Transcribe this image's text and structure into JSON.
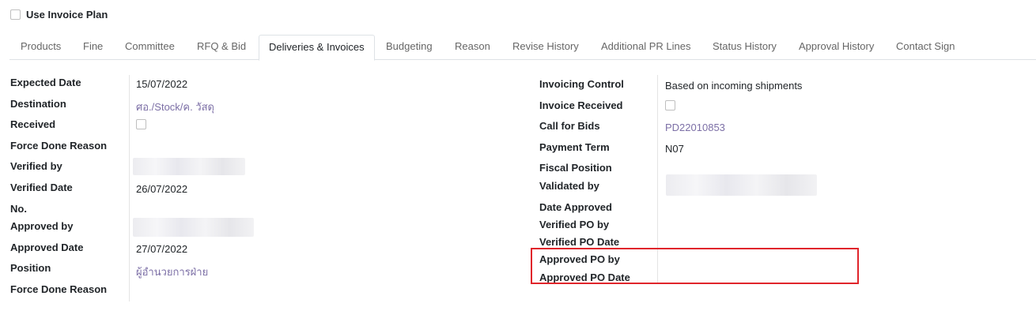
{
  "top": {
    "use_invoice_plan_label": "Use Invoice Plan",
    "use_invoice_plan_checked": false
  },
  "tabs": [
    {
      "label": "Products"
    },
    {
      "label": "Fine"
    },
    {
      "label": "Committee"
    },
    {
      "label": "RFQ & Bid"
    },
    {
      "label": "Deliveries & Invoices",
      "active": true
    },
    {
      "label": "Budgeting"
    },
    {
      "label": "Reason"
    },
    {
      "label": "Revise History"
    },
    {
      "label": "Additional PR Lines"
    },
    {
      "label": "Status History"
    },
    {
      "label": "Approval History"
    },
    {
      "label": "Contact Sign"
    }
  ],
  "left": {
    "expected_date_label": "Expected Date",
    "expected_date": "15/07/2022",
    "destination_label": "Destination",
    "destination": "ศอ./Stock/ค. วัสดุ",
    "received_label": "Received",
    "force_done_reason_label": "Force Done Reason",
    "verified_by_label": "Verified by",
    "verified_date_label": "Verified Date",
    "verified_date": "26/07/2022",
    "no_label": "No.",
    "approved_by_label": "Approved by",
    "approved_date_label": "Approved Date",
    "approved_date": "27/07/2022",
    "position_label": "Position",
    "position": "ผู้อำนวยการฝ่าย",
    "force_done_reason2_label": "Force Done Reason"
  },
  "right": {
    "invoicing_control_label": "Invoicing Control",
    "invoicing_control": "Based on incoming shipments",
    "invoice_received_label": "Invoice Received",
    "call_for_bids_label": "Call for Bids",
    "call_for_bids": "PD22010853",
    "payment_term_label": "Payment Term",
    "payment_term": "N07",
    "fiscal_position_label": "Fiscal Position",
    "validated_by_label": "Validated by",
    "date_approved_label": "Date Approved",
    "verified_po_by_label": "Verified PO by",
    "verified_po_date_label": "Verified PO Date",
    "approved_po_by_label": "Approved PO by",
    "approved_po_date_label": "Approved PO Date"
  },
  "colors": {
    "link": "#7c6fa6",
    "highlight_border": "#e0252b",
    "tab_border": "#dee2e6"
  }
}
